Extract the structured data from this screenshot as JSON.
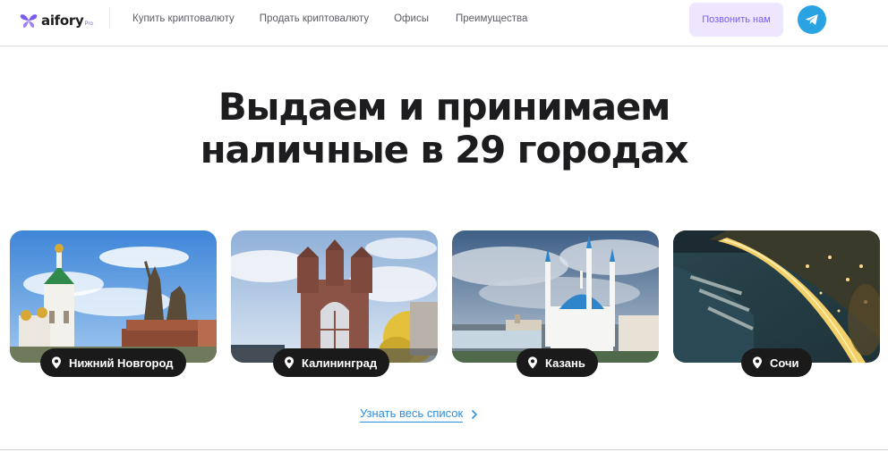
{
  "header": {
    "logo_text": "aifory",
    "logo_sub": "Pro",
    "nav": [
      "Купить криптовалюту",
      "Продать криптовалюту",
      "Офисы",
      "Преимущества"
    ],
    "call_label": "Позвонить нам"
  },
  "hero": {
    "line1": "Выдаем и принимаем",
    "line2": "наличные в 29 городах"
  },
  "cities": [
    {
      "name": "Нижний Новгород"
    },
    {
      "name": "Калининград"
    },
    {
      "name": "Казань"
    },
    {
      "name": "Сочи"
    }
  ],
  "more_link": "Узнать весь список",
  "colors": {
    "accent": "#7b5cf0",
    "call_bg": "#eee6ff",
    "telegram": "#2aa3e2",
    "link": "#2d8fe0",
    "pill": "#1a1a1a"
  },
  "icons": [
    "butterfly-logo-icon",
    "telegram-icon",
    "location-pin-icon",
    "chevron-right-icon"
  ]
}
